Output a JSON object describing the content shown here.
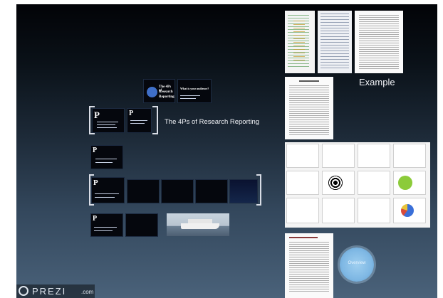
{
  "canvas": {
    "background_top": "#020307",
    "background_bottom": "#4a627a"
  },
  "group_caption": "The 4Ps of Research Reporting",
  "example_label": "Example",
  "nav_circle_label": "Overview",
  "logo": {
    "text": "PREZI",
    "suffix": ".com"
  },
  "slides": {
    "title_slide": {
      "line1": "The 4Ps of",
      "line2": "Research",
      "line3": "Reporting"
    },
    "what_slide": {
      "heading": "What is your audience?"
    },
    "purpose_slide": {
      "letter": "P",
      "word": "urpose"
    },
    "proposal_slide": {
      "letter": "P",
      "word": "roposal"
    },
    "presentation_slide": {
      "letter": "P",
      "word": "resentation"
    },
    "publication_slide": {
      "letter": "P",
      "word": "ublication"
    }
  },
  "colors": {
    "accent_circle": "#8fc3e8",
    "slide_bg": "#05070d",
    "doc_bg": "#fafafa"
  }
}
